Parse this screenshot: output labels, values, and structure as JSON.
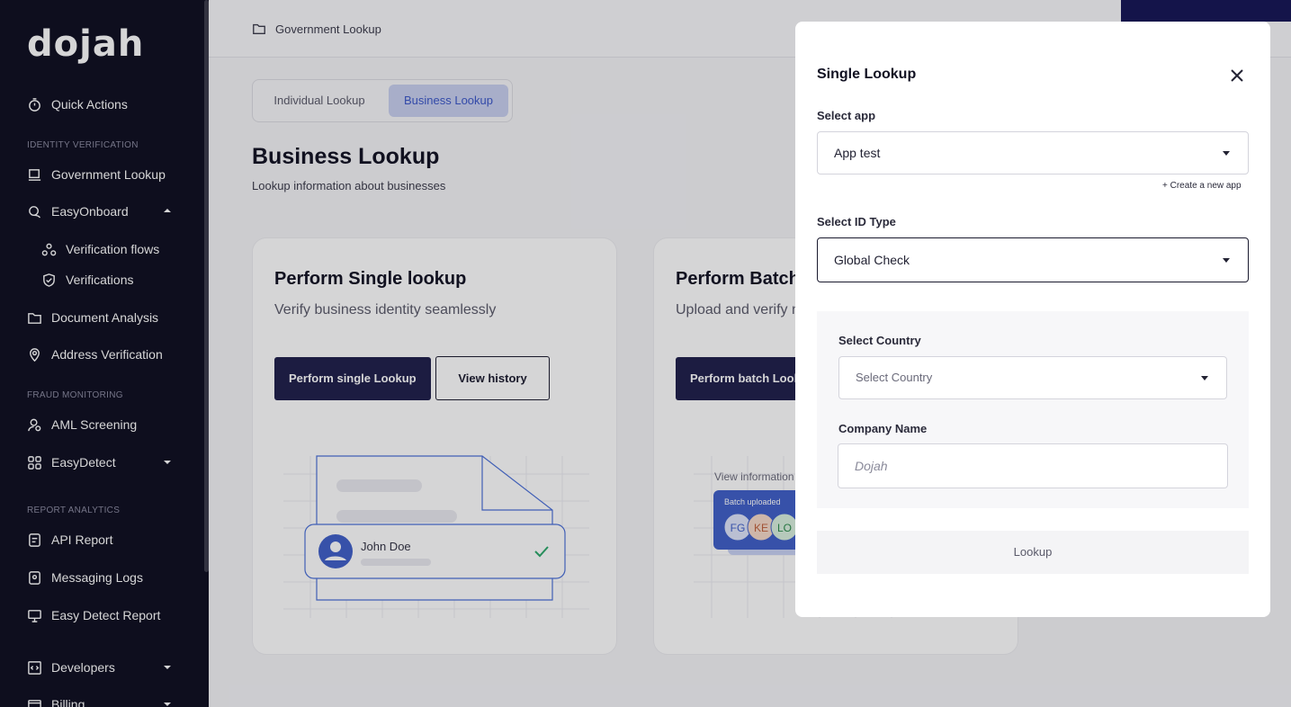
{
  "app": {
    "logo": "dojah"
  },
  "sidebar": {
    "quick_actions": "Quick Actions",
    "section_identity": "IDENTITY VERIFICATION",
    "government_lookup": "Government Lookup",
    "easyonboard": "EasyOnboard",
    "verification_flows": "Verification flows",
    "verifications": "Verifications",
    "document_analysis": "Document Analysis",
    "address_verification": "Address Verification",
    "section_fraud": "FRAUD MONITORING",
    "aml_screening": "AML Screening",
    "easydetect": "EasyDetect",
    "section_report": "REPORT ANALYTICS",
    "api_report": "API Report",
    "messaging_logs": "Messaging Logs",
    "easy_detect_report": "Easy Detect Report",
    "developers": "Developers",
    "billing": "Billing"
  },
  "header": {
    "breadcrumb": "Government Lookup"
  },
  "tabs": {
    "individual": "Individual Lookup",
    "business": "Business Lookup"
  },
  "page": {
    "title": "Business Lookup",
    "subtitle": "Lookup information about businesses"
  },
  "cards": {
    "single": {
      "title": "Perform Single lookup",
      "subtitle": "Verify business identity seamlessly",
      "primary_btn": "Perform single Lookup",
      "secondary_btn": "View history",
      "illus_name": "John Doe"
    },
    "batch": {
      "title": "Perform Batch",
      "subtitle": "Upload and verify m",
      "primary_btn": "Perform batch Look",
      "illus_view": "View information",
      "illus_batch": "Batch uploaded",
      "avatars": [
        "FG",
        "KE",
        "LO"
      ]
    }
  },
  "modal": {
    "title": "Single Lookup",
    "select_app_label": "Select app",
    "select_app_value": "App test",
    "create_app": "+ Create a new app",
    "id_type_label": "Select ID Type",
    "id_type_value": "Global Check",
    "country_label": "Select Country",
    "country_placeholder": "Select Country",
    "company_label": "Company Name",
    "company_placeholder": "Dojah",
    "lookup_btn": "Lookup"
  },
  "colors": {
    "sidebar_bg": "#0d0d1f",
    "primary": "#1e1e4a",
    "accent": "#3a56c8"
  }
}
